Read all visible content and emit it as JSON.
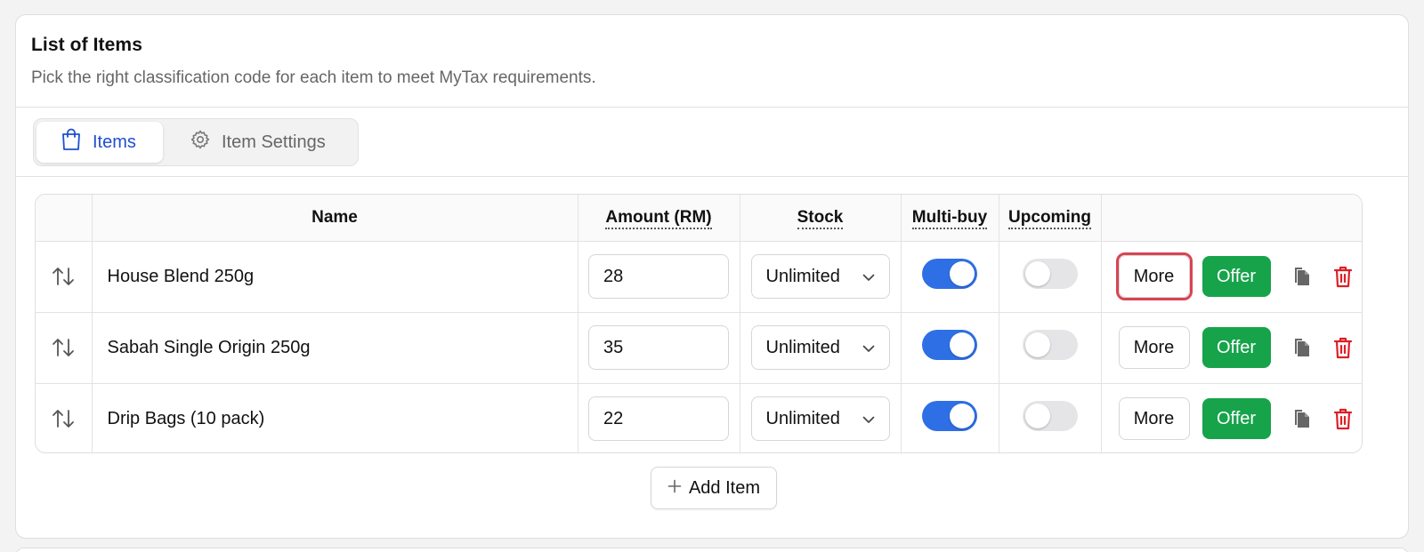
{
  "card": {
    "title": "List of Items",
    "subtitle": "Pick the right classification code for each item to meet MyTax requirements."
  },
  "tabs": [
    {
      "label": "Items",
      "icon": "shopping-bag-icon",
      "active": true
    },
    {
      "label": "Item Settings",
      "icon": "gear-icon",
      "active": false
    }
  ],
  "table": {
    "headers": {
      "name": "Name",
      "amount": "Amount (RM)",
      "stock": "Stock",
      "multibuy": "Multi-buy",
      "upcoming": "Upcoming"
    },
    "rows": [
      {
        "name": "House Blend 250g",
        "amount": "28",
        "stock": "Unlimited",
        "multibuy": true,
        "upcoming": false
      },
      {
        "name": "Sabah Single Origin 250g",
        "amount": "35",
        "stock": "Unlimited",
        "multibuy": true,
        "upcoming": false
      },
      {
        "name": "Drip Bags (10 pack)",
        "amount": "22",
        "stock": "Unlimited",
        "multibuy": true,
        "upcoming": false
      }
    ],
    "more_label": "More",
    "offer_label": "Offer"
  },
  "add_item_label": "Add Item",
  "colors": {
    "accent_blue": "#2f6fe6",
    "tab_active_text": "#1f4fd0",
    "offer_green": "#17a34a",
    "delete_red": "#dc1f26",
    "highlight_red": "#d84450"
  }
}
